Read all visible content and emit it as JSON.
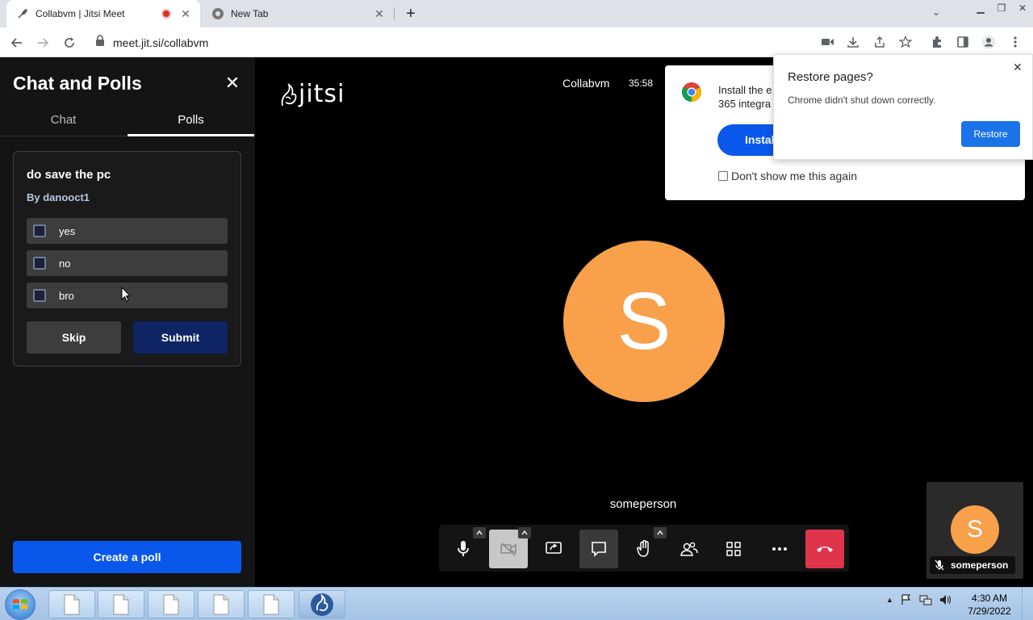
{
  "browser": {
    "tabs": [
      {
        "title": "Collabvm | Jitsi Meet"
      },
      {
        "title": "New Tab"
      }
    ],
    "url": "meet.jit.si/collabvm"
  },
  "sidebar": {
    "title": "Chat and Polls",
    "tabs": {
      "chat": "Chat",
      "polls": "Polls"
    },
    "poll": {
      "question": "do save the pc",
      "author": "By danooct1",
      "options": [
        "yes",
        "no",
        "bro"
      ],
      "skip_label": "Skip",
      "submit_label": "Submit"
    },
    "create_label": "Create a poll"
  },
  "meeting": {
    "logo_text": "jitsi",
    "name": "Collabvm",
    "timer": "35:58",
    "speaker_initial": "S",
    "speaker_name": "someperson",
    "thumbnail": {
      "initial": "S",
      "name": "someperson"
    }
  },
  "install_popup": {
    "line1": "Install the e",
    "line2": "365 integra",
    "button": "Instal",
    "dont_show": "Don't show me this again"
  },
  "restore_popup": {
    "title": "Restore pages?",
    "message": "Chrome didn't shut down correctly.",
    "button": "Restore"
  },
  "taskbar": {
    "time": "4:30 AM",
    "date": "7/29/2022"
  },
  "colors": {
    "accent_blue": "#0a57eb",
    "avatar_orange": "#f8a04a",
    "hangup_red": "#e0344c"
  }
}
